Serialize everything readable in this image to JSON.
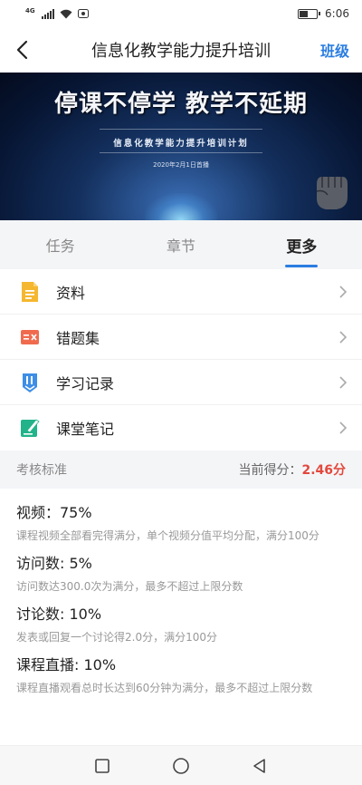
{
  "status": {
    "network": "4G",
    "time": "6:06"
  },
  "header": {
    "title": "信息化教学能力提升培训",
    "right_link": "班级"
  },
  "banner": {
    "headline": "停课不停学  教学不延期",
    "subtitle": "信息化教学能力提升培训计划",
    "date": "2020年2月1日首播"
  },
  "tabs": [
    {
      "label": "任务",
      "active": false
    },
    {
      "label": "章节",
      "active": false
    },
    {
      "label": "更多",
      "active": true
    }
  ],
  "list": [
    {
      "label": "资料",
      "icon": "document-icon",
      "color": "#f5b730"
    },
    {
      "label": "错题集",
      "icon": "wrong-answers-icon",
      "color": "#f06b4e"
    },
    {
      "label": "学习记录",
      "icon": "study-record-icon",
      "color": "#3d8ee6"
    },
    {
      "label": "课堂笔记",
      "icon": "note-icon",
      "color": "#22b38a"
    }
  ],
  "assessment": {
    "header_left": "考核标准",
    "score_label": "当前得分：",
    "score_value": "2.46分",
    "items": [
      {
        "title": "视频：75%",
        "desc": "课程视频全部看完得满分，单个视频分值平均分配，满分100分"
      },
      {
        "title": "访问数: 5%",
        "desc": "访问数达300.0次为满分，最多不超过上限分数"
      },
      {
        "title": "讨论数: 10%",
        "desc": "发表或回复一个讨论得2.0分，满分100分"
      },
      {
        "title": "课程直播: 10%",
        "desc": "课程直播观看总时长达到60分钟为满分，最多不超过上限分数"
      }
    ]
  },
  "colors": {
    "accent": "#2a7de1",
    "score": "#e2483d"
  }
}
